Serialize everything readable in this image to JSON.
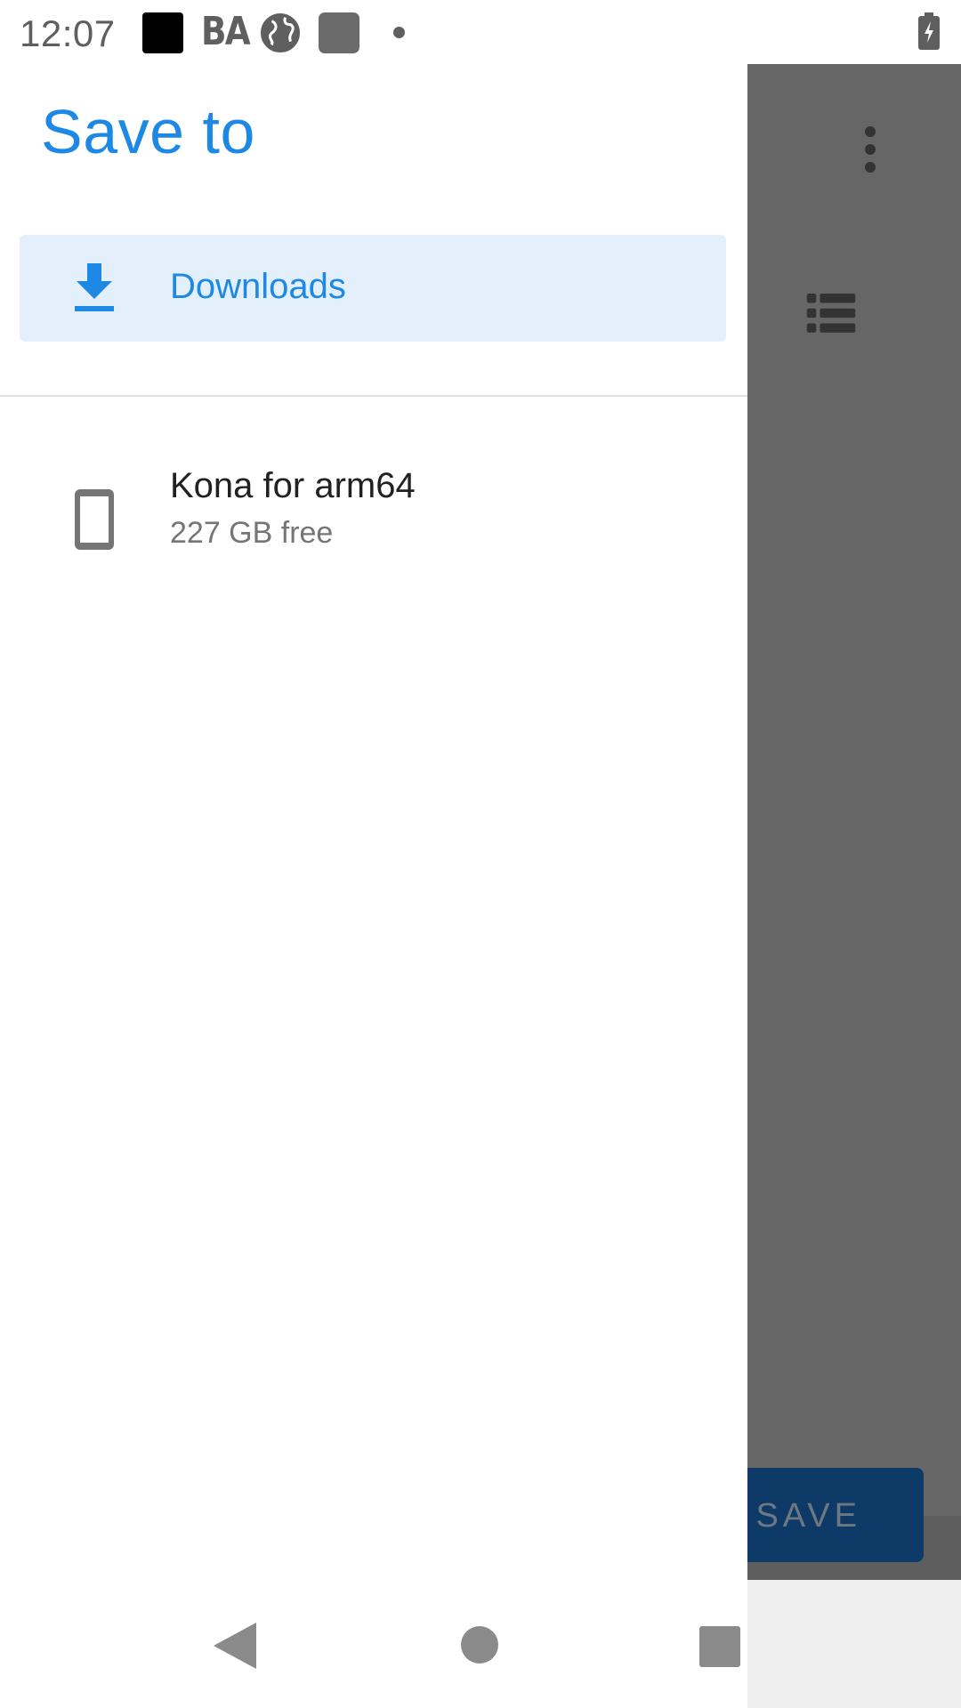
{
  "status_bar": {
    "time": "12:07",
    "icons": [
      "black-square-icon",
      "ba-icon",
      "globe-icon",
      "gray-square-icon",
      "dot-icon",
      "battery-charging-icon"
    ],
    "ba_text": "BA"
  },
  "drawer": {
    "title": "Save to",
    "roots": [
      {
        "label": "Downloads",
        "icon": "download-icon",
        "selected": true
      }
    ],
    "devices": [
      {
        "name": "Kona for arm64",
        "free": "227 GB free",
        "icon": "phone-icon"
      }
    ]
  },
  "background": {
    "save_label": "SAVE",
    "icons": [
      "overflow-menu-icon",
      "list-view-icon"
    ]
  },
  "nav_bar": {
    "icons": [
      "back-icon",
      "home-icon",
      "recents-icon"
    ]
  },
  "colors": {
    "accent": "#1e88e5",
    "selected_bg": "#e3f0fb",
    "scrim": "#666666",
    "save_button": "#0d3a66"
  }
}
